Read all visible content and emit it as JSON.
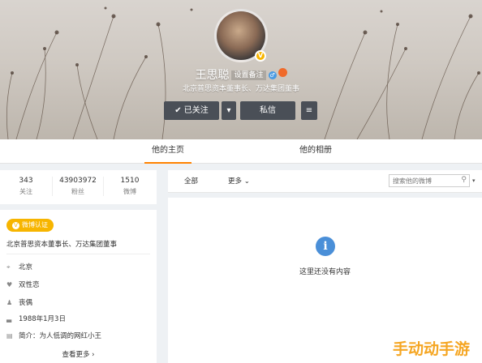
{
  "profile": {
    "name": "王思聪",
    "remark": "设置备注",
    "intro": "北京普思资本董事长、万达集团董事",
    "follow_label": "已关注",
    "message_label": "私信"
  },
  "tabs": {
    "home": "他的主页",
    "album": "他的相册"
  },
  "stats": [
    {
      "value": "343",
      "label": "关注"
    },
    {
      "value": "43903972",
      "label": "粉丝"
    },
    {
      "value": "1510",
      "label": "微博"
    }
  ],
  "info": {
    "verified_tag": "微博认证",
    "verified_desc": "北京普思资本董事长、万达集团董事",
    "location": "北京",
    "orientation": "双性恋",
    "relationship": "丧偶",
    "birthday": "1988年1月3日",
    "bio": "简介：为人低调的网红小王",
    "more": "查看更多"
  },
  "feed": {
    "all_label": "全部",
    "more_label": "更多",
    "search_placeholder": "搜索他的微博",
    "empty_text": "这里还没有内容"
  },
  "watermark": "手动动手游",
  "icons": [
    "check-icon",
    "caret-down-icon",
    "menu-icon",
    "verified-badge-icon",
    "male-icon",
    "medal-icon",
    "location-icon",
    "heart-icon",
    "person-icon",
    "cake-icon",
    "note-icon",
    "search-icon",
    "info-icon"
  ]
}
